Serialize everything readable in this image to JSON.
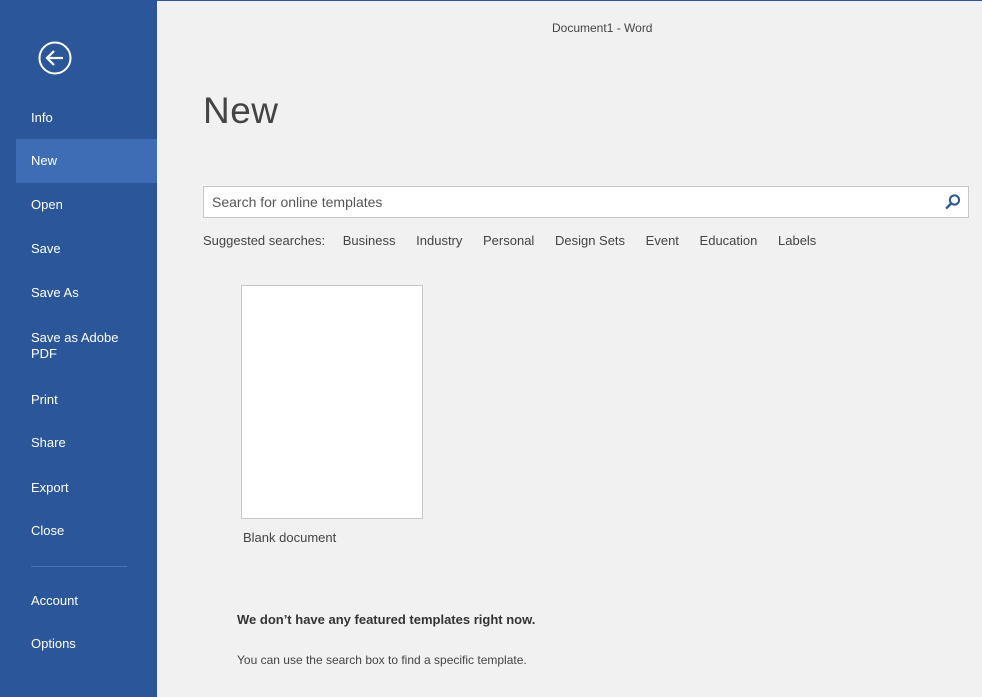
{
  "window": {
    "title": "Document1 - Word"
  },
  "sidebar": {
    "back_icon": "back-arrow-circle-icon",
    "items": [
      {
        "label": "Info"
      },
      {
        "label": "New",
        "selected": true
      },
      {
        "label": "Open"
      },
      {
        "label": "Save"
      },
      {
        "label": "Save As"
      },
      {
        "label": "Save as Adobe PDF"
      },
      {
        "label": "Print"
      },
      {
        "label": "Share"
      },
      {
        "label": "Export"
      },
      {
        "label": "Close"
      },
      {
        "label": "Account"
      },
      {
        "label": "Options"
      }
    ]
  },
  "main": {
    "title": "New",
    "search": {
      "placeholder": "Search for online templates",
      "value": "",
      "icon": "search-icon"
    },
    "suggested": {
      "label": "Suggested searches:",
      "links": [
        "Business",
        "Industry",
        "Personal",
        "Design Sets",
        "Event",
        "Education",
        "Labels"
      ]
    },
    "templates": [
      {
        "label": "Blank document"
      }
    ],
    "no_featured_message": "We don’t have any featured templates right now.",
    "hint": "You can use the search box to find a specific template."
  },
  "colors": {
    "sidebar_bg": "#2b579a",
    "sidebar_selected": "#3e6db5",
    "content_bg": "#f1f1f1",
    "search_icon": "#2b579a"
  }
}
